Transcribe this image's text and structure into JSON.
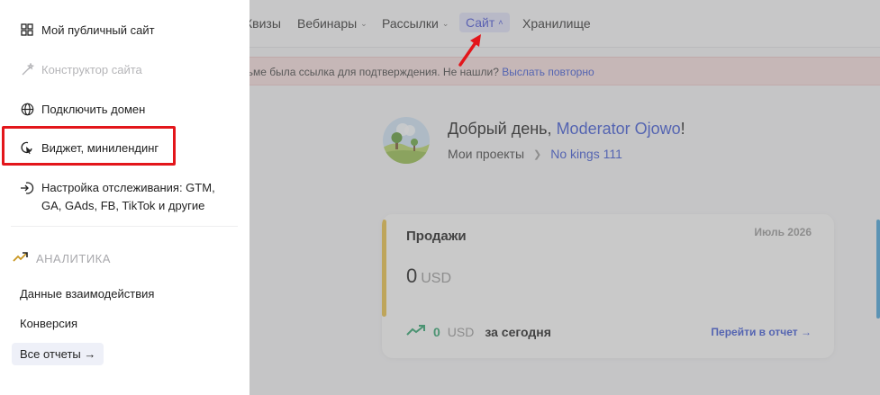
{
  "topnav": {
    "items": [
      {
        "label": "Квизы",
        "chevron": false
      },
      {
        "label": "Вебинары",
        "chevron": true
      },
      {
        "label": "Рассылки",
        "chevron": true
      },
      {
        "label": "Сайт",
        "chevron": true,
        "active": true
      },
      {
        "label": "Хранилище",
        "chevron": false
      }
    ]
  },
  "notice": {
    "text": "исьме была ссылка для подтверждения. Не нашли?",
    "link": "Выслать повторно"
  },
  "greeting": {
    "prefix": "Добрый день, ",
    "name": "Moderator Ojowo",
    "suffix": "!",
    "crumb_root": "Мои проекты",
    "crumb_project": "No kings 111"
  },
  "sales_card": {
    "title": "Продажи",
    "period": "Июль 2026",
    "amount": "0",
    "currency": "USD",
    "today_amount": "0",
    "today_currency": "USD",
    "today_label": "за сегодня",
    "report_link": "Перейти в отчет →"
  },
  "menu": {
    "items": [
      {
        "label": "Мой публичный сайт",
        "icon": "grid-icon"
      },
      {
        "label": "Конструктор сайта",
        "icon": "magic-wand-icon",
        "disabled": true
      },
      {
        "label": "Подключить домен",
        "icon": "globe-icon"
      },
      {
        "label": "Виджет, минилендинг",
        "icon": "widget-icon"
      },
      {
        "label": "Настройка отслеживания: GTM, GA, GAds, FB, TikTok и другие",
        "icon": "tracking-icon"
      }
    ],
    "analytics_header": "АНАЛИТИКА",
    "analytics_items": [
      "Данные взаимодействия",
      "Конверсия"
    ],
    "all_reports": "Все отчеты →"
  },
  "colors": {
    "accent_blue": "#3e58d4",
    "highlight_red": "#e3161b",
    "card_accent": "#e8c14a",
    "success_green": "#2fa46f"
  }
}
